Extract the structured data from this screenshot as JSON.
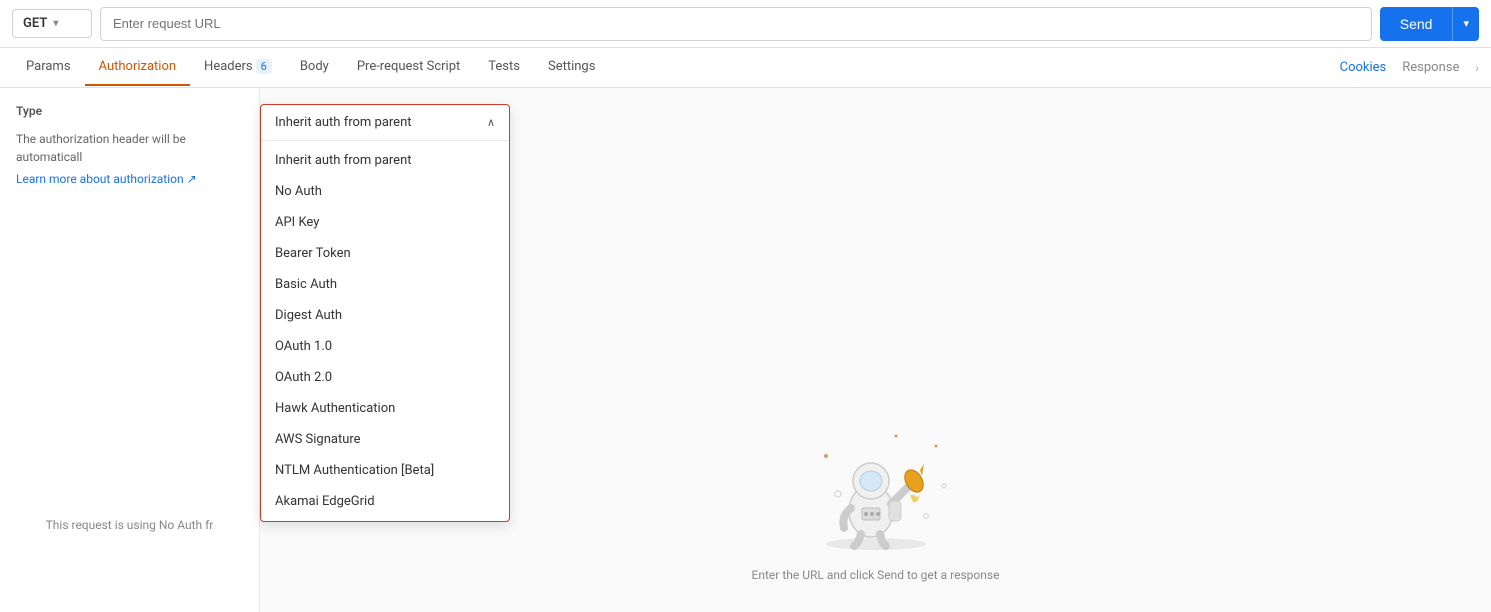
{
  "urlBar": {
    "method": "GET",
    "urlPlaceholder": "Enter request URL",
    "sendLabel": "Send"
  },
  "tabs": {
    "items": [
      {
        "id": "params",
        "label": "Params",
        "badge": null
      },
      {
        "id": "authorization",
        "label": "Authorization",
        "badge": null,
        "active": true
      },
      {
        "id": "headers",
        "label": "Headers",
        "badge": "6"
      },
      {
        "id": "body",
        "label": "Body",
        "badge": null
      },
      {
        "id": "pre-request-script",
        "label": "Pre-request Script",
        "badge": null
      },
      {
        "id": "tests",
        "label": "Tests",
        "badge": null
      },
      {
        "id": "settings",
        "label": "Settings",
        "badge": null
      }
    ],
    "cookiesLabel": "Cookies",
    "responseLabel": "Response"
  },
  "leftPanel": {
    "typeLabel": "Type",
    "description": "The authorization header will be automaticall",
    "learnMoreText": "Learn more about authorization",
    "learnMoreIcon": "↗",
    "noAuthText": "This request is using No Auth fr"
  },
  "dropdown": {
    "selectedLabel": "Inherit auth from parent",
    "chevronUp": "∧",
    "items": [
      "Inherit auth from parent",
      "No Auth",
      "API Key",
      "Bearer Token",
      "Basic Auth",
      "Digest Auth",
      "OAuth 1.0",
      "OAuth 2.0",
      "Hawk Authentication",
      "AWS Signature",
      "NTLM Authentication [Beta]",
      "Akamai EdgeGrid"
    ]
  },
  "emptyState": {
    "text": "Enter the URL and click Send to get a response"
  }
}
